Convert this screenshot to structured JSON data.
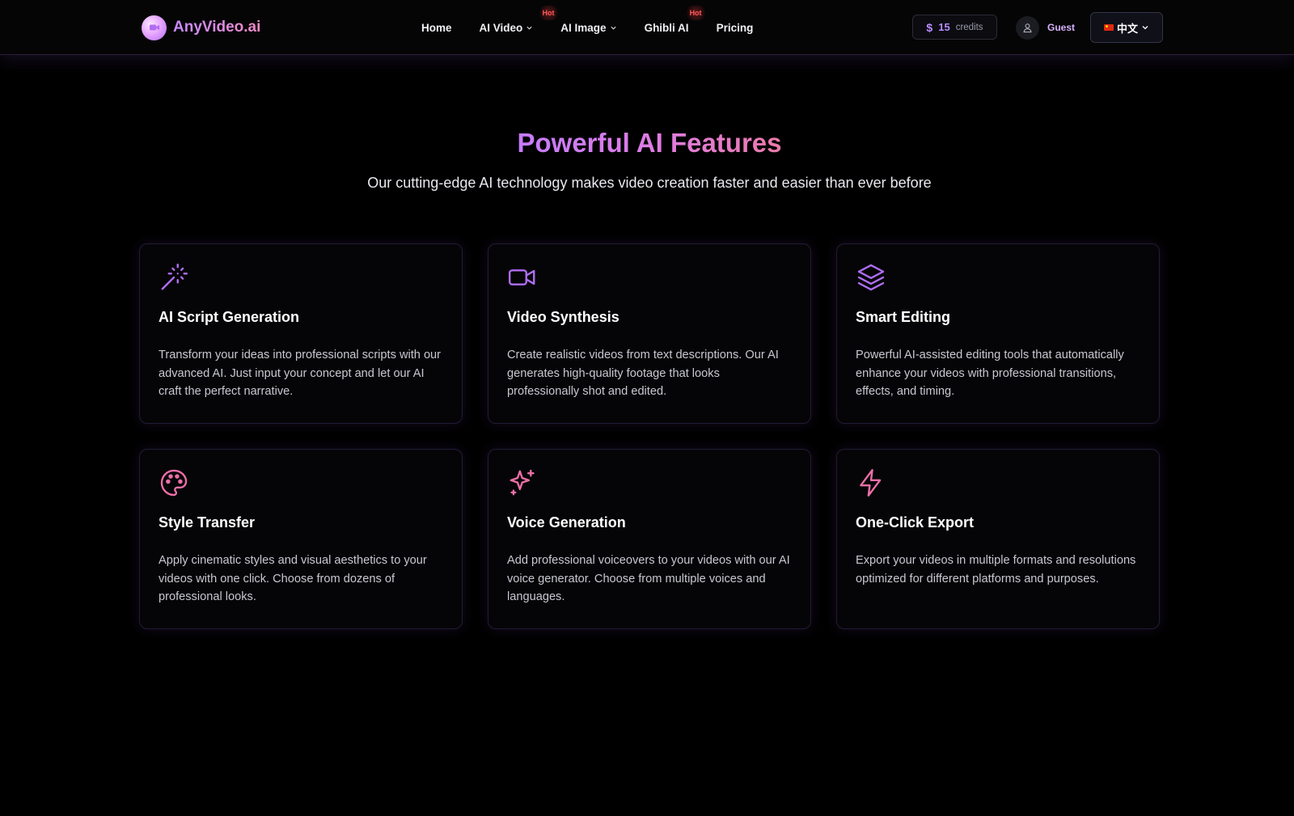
{
  "brand": {
    "name": "AnyVideo.ai"
  },
  "nav": {
    "items": [
      {
        "label": "Home",
        "hot": false,
        "dropdown": false
      },
      {
        "label": "AI Video",
        "hot": true,
        "dropdown": true
      },
      {
        "label": "AI Image",
        "hot": false,
        "dropdown": true
      },
      {
        "label": "Ghibli AI",
        "hot": true,
        "dropdown": false
      },
      {
        "label": "Pricing",
        "hot": false,
        "dropdown": false
      }
    ],
    "hot_label": "Hot"
  },
  "credits": {
    "symbol": "$",
    "amount": "15",
    "label": "credits"
  },
  "user": {
    "name": "Guest"
  },
  "language": {
    "label": "中文"
  },
  "features": {
    "title": "Powerful AI Features",
    "subtitle": "Our cutting-edge AI technology makes video creation faster and easier than ever before",
    "cards": [
      {
        "icon": "magic-wand-icon",
        "title": "AI Script Generation",
        "description": "Transform your ideas into professional scripts with our advanced AI. Just input your concept and let our AI craft the perfect narrative."
      },
      {
        "icon": "video-camera-icon",
        "title": "Video Synthesis",
        "description": "Create realistic videos from text descriptions. Our AI generates high-quality footage that looks professionally shot and edited."
      },
      {
        "icon": "layers-icon",
        "title": "Smart Editing",
        "description": "Powerful AI-assisted editing tools that automatically enhance your videos with professional transitions, effects, and timing."
      },
      {
        "icon": "palette-icon",
        "title": "Style Transfer",
        "description": "Apply cinematic styles and visual aesthetics to your videos with one click. Choose from dozens of professional looks."
      },
      {
        "icon": "sparkles-icon",
        "title": "Voice Generation",
        "description": "Add professional voiceovers to your videos with our AI voice generator. Choose from multiple voices and languages."
      },
      {
        "icon": "lightning-icon",
        "title": "One-Click Export",
        "description": "Export your videos in multiple formats and resolutions optimized for different platforms and purposes."
      }
    ]
  },
  "colors": {
    "accent_purple": "#b98cff",
    "accent_pink": "#ec7aab",
    "hot_red": "#ff5a5a",
    "background": "#000000"
  }
}
